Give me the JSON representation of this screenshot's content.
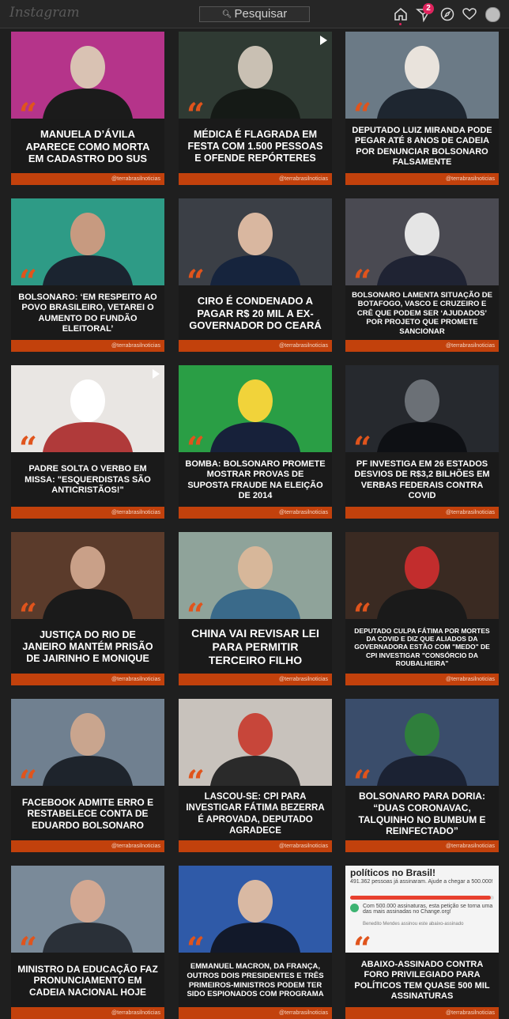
{
  "app": {
    "logo": "Instagram"
  },
  "search": {
    "placeholder": "Pesquisar"
  },
  "nav": {
    "notification_count": "2"
  },
  "brand": {
    "accent": "#c2410c",
    "quote": "#e0541c"
  },
  "posts": [
    {
      "headline": "MANUELA D’ÁVILA APARECE COMO MORTA EM CADASTRO DO SUS",
      "handle": "@terrabrasilnoticias",
      "photo": "woman-portrait",
      "size": 13
    },
    {
      "headline": "MÉDICA É FLAGRADA EM FESTA COM 1.500 PESSOAS E OFENDE REPÓRTERES",
      "handle": "@terrabrasilnoticias",
      "photo": "video-still",
      "size": 12.5,
      "video": true
    },
    {
      "headline": "DEPUTADO LUIZ MIRANDA PODE PEGAR ATÉ 8 ANOS DE CADEIA POR DENUNCIAR BOLSONARO FALSAMENTE",
      "handle": "@terrabrasilnoticias",
      "photo": "man-mask",
      "size": 11
    },
    {
      "headline": "BOLSONARO: ‘EM RESPEITO AO POVO BRASILEIRO, VETAREI O AUMENTO DO FUNDÃO ELEITORAL’",
      "handle": "@terrabrasilnoticias",
      "photo": "man-banner",
      "size": 11
    },
    {
      "headline": "CIRO É CONDENADO A PAGAR R$ 20 MIL A EX-GOVERNADOR DO CEARÁ",
      "handle": "@terrabrasilnoticias",
      "photo": "man-suit",
      "size": 13
    },
    {
      "headline": "BOLSONARO LAMENTA SITUAÇÃO DE BOTAFOGO, VASCO E CRUZEIRO E CRÊ QUE PODEM SER ‘AJUDADOS’ POR PROJETO QUE PROMETE SANCIONAR",
      "handle": "@terrabrasilnoticias",
      "photo": "man-desk",
      "size": 9.5
    },
    {
      "headline": "PADRE SOLTA O VERBO EM MISSA: \"ESQUERDISTAS SÃO ANTICRISTÃOS!\"",
      "handle": "@terrabrasilnoticias",
      "photo": "church",
      "size": 11,
      "video": true
    },
    {
      "headline": "BOMBA: BOLSONARO PROMETE MOSTRAR PROVAS DE SUPOSTA FRAUDE NA ELEIÇÃO DE 2014",
      "handle": "@terrabrasilnoticias",
      "photo": "flag",
      "size": 11
    },
    {
      "headline": "PF INVESTIGA EM 26 ESTADOS DESVIOS DE R$3,2 BILHÕES EM VERBAS FEDERAIS CONTRA COVID",
      "handle": "@terrabrasilnoticias",
      "photo": "cars",
      "size": 11
    },
    {
      "headline": "JUSTIÇA DO RIO DE JANEIRO MANTÉM PRISÃO DE JAIRINHO E MONIQUE",
      "handle": "@terrabrasilnoticias",
      "photo": "crowd",
      "size": 12.5
    },
    {
      "headline": "CHINA VAI REVISAR LEI PARA PERMITIR TERCEIRO FILHO",
      "handle": "@terrabrasilnoticias",
      "photo": "park",
      "size": 14
    },
    {
      "headline": "DEPUTADO CULPA FÁTIMA POR MORTES DA COVID E DIZ QUE ALIADOS DA GOVERNADORA ESTÃO COM \"MEDO\" DE CPI INVESTIGAR \"CONSÓRCIO DA ROUBALHEIRA\"",
      "handle": "@terrabrasilnoticias",
      "photo": "old-man",
      "size": 8.5
    },
    {
      "headline": "FACEBOOK ADMITE ERRO E RESTABELECE CONTA DE EDUARDO BOLSONARO",
      "handle": "@terrabrasilnoticias",
      "photo": "young-man",
      "size": 12
    },
    {
      "headline": "LASCOU-SE: CPI PARA INVESTIGAR FÁTIMA BEZERRA É APROVADA, DEPUTADO AGRADECE",
      "handle": "@terrabrasilnoticias",
      "photo": "woman-mics",
      "size": 11.5
    },
    {
      "headline": "BOLSONARO PARA DORIA: “DUAS CORONAVAC, TALQUINHO NO BUMBUM E REINFECTADO”",
      "handle": "@terrabrasilnoticias",
      "photo": "two-men",
      "size": 12
    },
    {
      "headline": "MINISTRO DA EDUCAÇÃO FAZ PRONUNCIAMENTO EM CADEIA NACIONAL HOJE",
      "handle": "@terrabrasilnoticias",
      "photo": "glasses-man",
      "size": 12
    },
    {
      "headline": "EMMANUEL MACRON, DA FRANÇA, OUTROS DOIS PRESIDENTES E TRÊS PRIMEIROS-MINISTROS PODEM TER SIDO ESPIONADOS COM PROGRAMA",
      "handle": "@terrabrasilnoticias",
      "photo": "macron",
      "size": 9.5
    },
    {
      "headline": "ABAIXO-ASSINADO CONTRA FORO PRIVILEGIADO PARA POLÍTICOS TEM QUASE 500 MIL ASSINATURAS",
      "handle": "@terrabrasilnoticias",
      "photo": "petition",
      "size": 11
    }
  ],
  "petition": {
    "title": "políticos no Brasil!",
    "count_line": "491.362 pessoas já assinaram. Ajude a chegar a 500.000!",
    "progress": 0.98,
    "goal_line": "Com 500.000 assinaturas, esta petição se torna uma das mais assinadas no Change.org!",
    "signer_line": "Benedito Mendes assinou este abaixo-assinado"
  }
}
